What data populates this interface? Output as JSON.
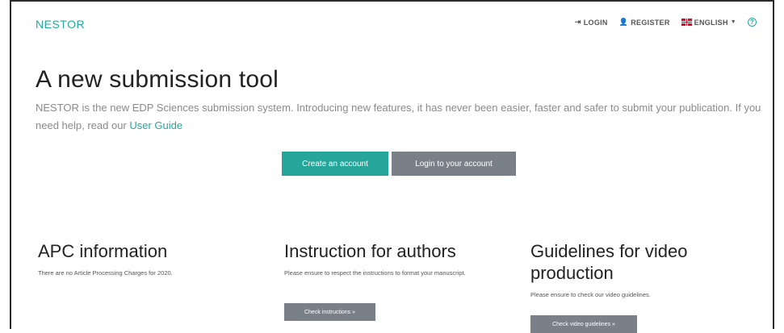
{
  "nav": {
    "brand": "NESTOR",
    "login": "LOGIN",
    "register": "REGISTER",
    "language": "ENGLISH",
    "help": "?"
  },
  "hero": {
    "title": "A new submission tool",
    "text": "NESTOR is the new EDP Sciences submission system. Introducing new features, it has never been easier, faster and safer to submit your publication. If you need help, read our ",
    "link": "User Guide",
    "create_button": "Create an account",
    "login_button": "Login to your account"
  },
  "columns": [
    {
      "title": "APC information",
      "text": "There are no Article Processing Charges for 2020."
    },
    {
      "title": "Instruction for authors",
      "text": "Please ensure to respect the instructions to format your manuscript.",
      "button": "Check instructions »"
    },
    {
      "title": "Guidelines for video production",
      "text": "Please ensure to check our video guidelines.",
      "button": "Check video guidelines »"
    }
  ],
  "colors": {
    "accent": "#26a69a",
    "secondary": "#7a8088"
  }
}
